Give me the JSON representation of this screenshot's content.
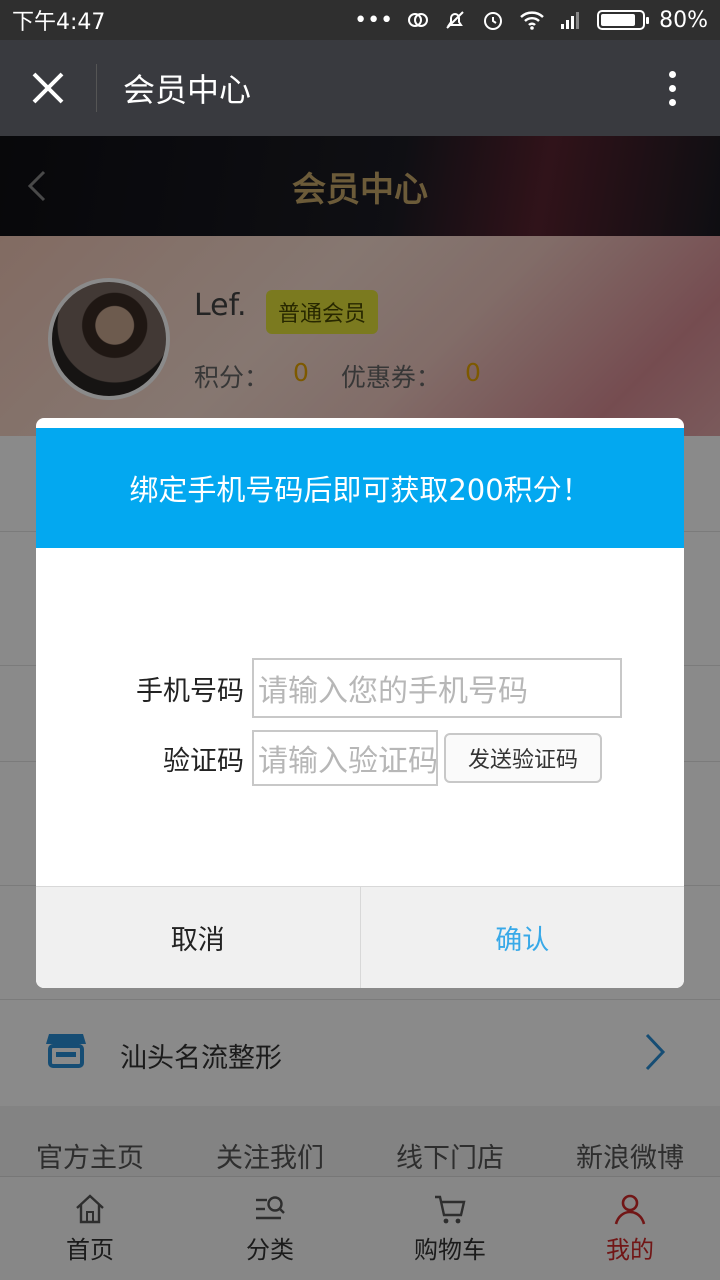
{
  "status_bar": {
    "time": "下午4:47",
    "battery": "80%"
  },
  "wechat_header": {
    "title": "会员中心"
  },
  "page_header": {
    "title": "会员中心"
  },
  "profile": {
    "name": "Lef.",
    "level": "普通会员",
    "points_label": "积分：",
    "points_value": "0",
    "coupon_label": "优惠券：",
    "coupon_value": "0"
  },
  "store": {
    "name": "汕头名流整形"
  },
  "footer_links": [
    "官方主页",
    "关注我们",
    "线下门店",
    "新浪微博"
  ],
  "tabbar": [
    {
      "label": "首页",
      "icon": "home-icon"
    },
    {
      "label": "分类",
      "icon": "category-search-icon"
    },
    {
      "label": "购物车",
      "icon": "cart-icon"
    },
    {
      "label": "我的",
      "icon": "user-icon",
      "active": true
    }
  ],
  "dialog": {
    "title": "绑定手机号码后即可获取200积分！",
    "phone_label": "手机号码",
    "phone_placeholder": "请输入您的手机号码",
    "code_label": "验证码",
    "code_placeholder": "请输入验证码",
    "send_code": "发送验证码",
    "cancel": "取消",
    "confirm": "确认"
  },
  "colors": {
    "dialog_header": "#03a8f0",
    "confirm": "#38a9e8",
    "active_tab": "#d12a2a",
    "points": "#e8a500",
    "level_badge": "#e4e23a"
  }
}
